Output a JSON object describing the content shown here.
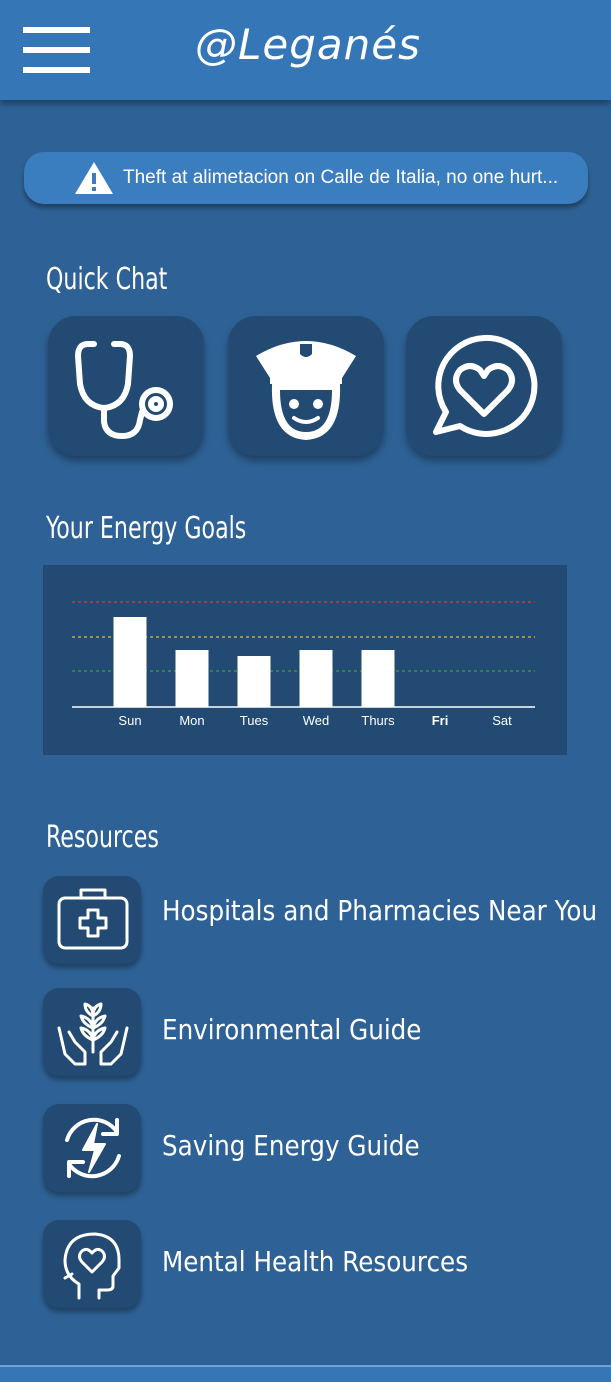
{
  "header": {
    "menu_icon": "hamburger-menu-icon",
    "title": "@Leganés"
  },
  "alert": {
    "icon": "warning-triangle-icon",
    "text": "Theft at alimetacion on Calle de Italia, no one hurt..."
  },
  "quick_chat": {
    "title": "Quick Chat",
    "buttons": [
      {
        "icon": "stethoscope-icon"
      },
      {
        "icon": "police-officer-icon"
      },
      {
        "icon": "heart-chat-icon"
      }
    ]
  },
  "energy": {
    "title": "Your Energy Goals"
  },
  "chart_data": {
    "type": "bar",
    "categories": [
      "Sun",
      "Mon",
      "Tues",
      "Wed",
      "Thurs",
      "Fri",
      "Sat"
    ],
    "values": [
      90,
      57,
      51,
      57,
      57,
      null,
      null
    ],
    "highlight_category": "Fri",
    "reference_lines": [
      {
        "value": 105,
        "color": "#d93a3a"
      },
      {
        "value": 70,
        "color": "#d9c23a"
      },
      {
        "value": 36,
        "color": "#3aa53a"
      }
    ],
    "ylim": [
      0,
      120
    ],
    "bar_color": "#ffffff",
    "title": "",
    "xlabel": "",
    "ylabel": ""
  },
  "resources": {
    "title": "Resources",
    "items": [
      {
        "icon": "first-aid-kit-icon",
        "label": "Hospitals and Pharmacies Near You"
      },
      {
        "icon": "plant-hands-icon",
        "label": "Environmental Guide"
      },
      {
        "icon": "energy-cycle-icon",
        "label": "Saving Energy Guide"
      },
      {
        "icon": "head-heart-icon",
        "label": "Mental Health Resources"
      }
    ]
  },
  "colors": {
    "background": "#2e6296",
    "header": "#3576b7",
    "panel": "#224a72",
    "alert": "#3b7ec0"
  }
}
